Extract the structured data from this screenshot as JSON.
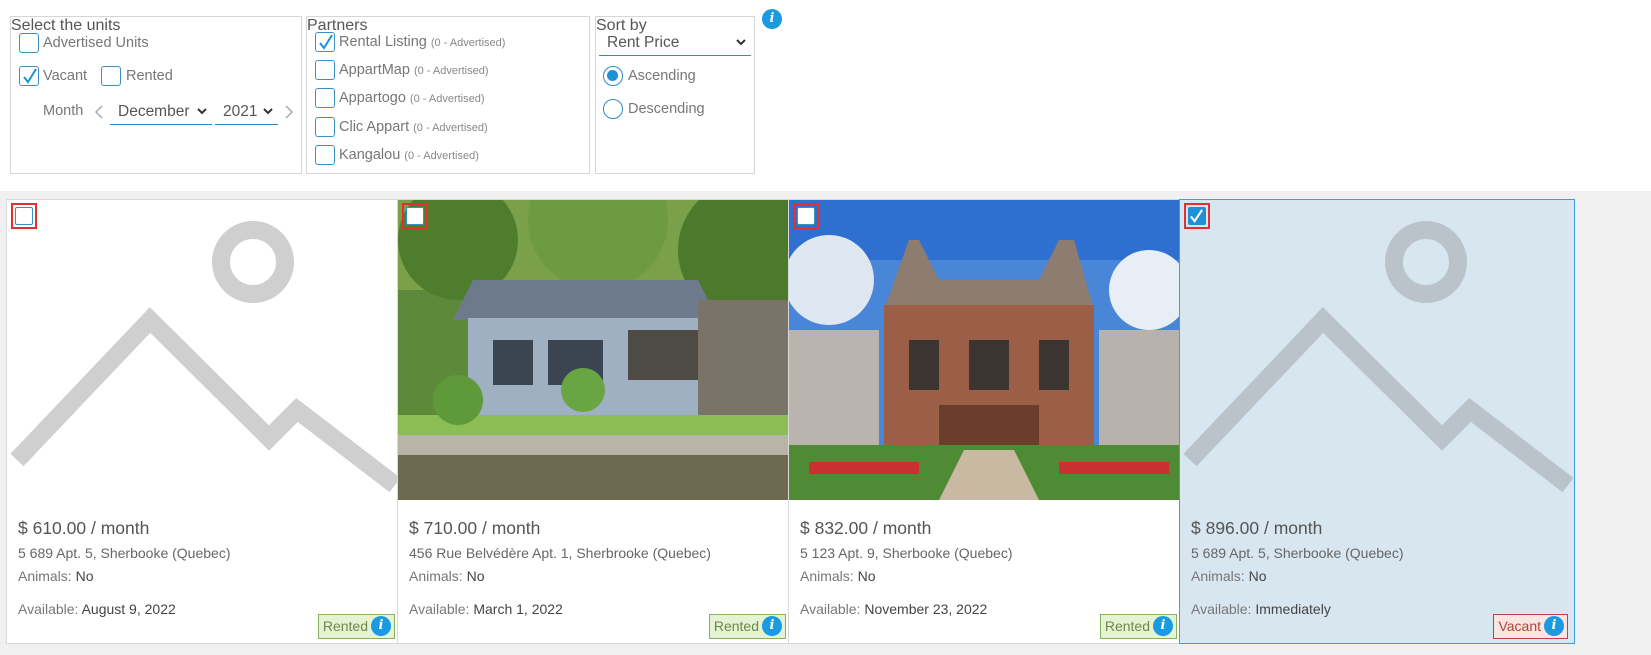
{
  "filters": {
    "units": {
      "legend": "Select the units",
      "advertised_label": "Advertised Units",
      "vacant_label": "Vacant",
      "rented_label": "Rented",
      "month_label": "Month",
      "month_value": "December",
      "year_value": "2021"
    },
    "partners": {
      "legend": "Partners",
      "items": [
        {
          "name": "Rental Listing",
          "note": "(0 - Advertised)",
          "checked": true
        },
        {
          "name": "AppartMap",
          "note": "(0 - Advertised)",
          "checked": false
        },
        {
          "name": "Appartogo",
          "note": "(0 - Advertised)",
          "checked": false
        },
        {
          "name": "Clic Appart",
          "note": "(0 - Advertised)",
          "checked": false
        },
        {
          "name": "Kangalou",
          "note": "(0 - Advertised)",
          "checked": false
        }
      ]
    },
    "sort": {
      "legend": "Sort by",
      "field_value": "Rent Price",
      "ascending_label": "Ascending",
      "descending_label": "Descending",
      "selected": "Ascending"
    },
    "info_glyph": "i"
  },
  "listings": [
    {
      "price": "$ 610.00 / month",
      "address": "5 689 Apt. 5, Sherbooke (Quebec)",
      "animals_label": "Animals:",
      "animals": "No",
      "available_label": "Available:",
      "available": "August 9, 2022",
      "status": "Rented",
      "selected": false,
      "photo": "placeholder-image-icon"
    },
    {
      "price": "$ 710.00 / month",
      "address": "456 Rue Belvédère Apt. 1, Sherbrooke (Quebec)",
      "animals_label": "Animals:",
      "animals": "No",
      "available_label": "Available:",
      "available": "March 1, 2022",
      "status": "Rented",
      "selected": false,
      "photo": "lake-cottage-photo"
    },
    {
      "price": "$ 832.00 / month",
      "address": "5 123 Apt. 9, Sherbooke (Quebec)",
      "animals_label": "Animals:",
      "animals": "No",
      "available_label": "Available:",
      "available": "November 23, 2022",
      "status": "Rented",
      "selected": false,
      "photo": "stone-building-photo"
    },
    {
      "price": "$ 896.00 / month",
      "address": "5 689 Apt. 5, Sherbooke (Quebec)",
      "animals_label": "Animals:",
      "animals": "No",
      "available_label": "Available:",
      "available": "Immediately",
      "status": "Vacant",
      "selected": true,
      "photo": "placeholder-image-icon"
    }
  ],
  "colors": {
    "accent": "#1e90d6",
    "rented_bg": "#e4f3d3",
    "vacant_border": "#c0433b",
    "selected_card_bg": "#d7e6ef",
    "selection_outline": "#e0302f"
  }
}
